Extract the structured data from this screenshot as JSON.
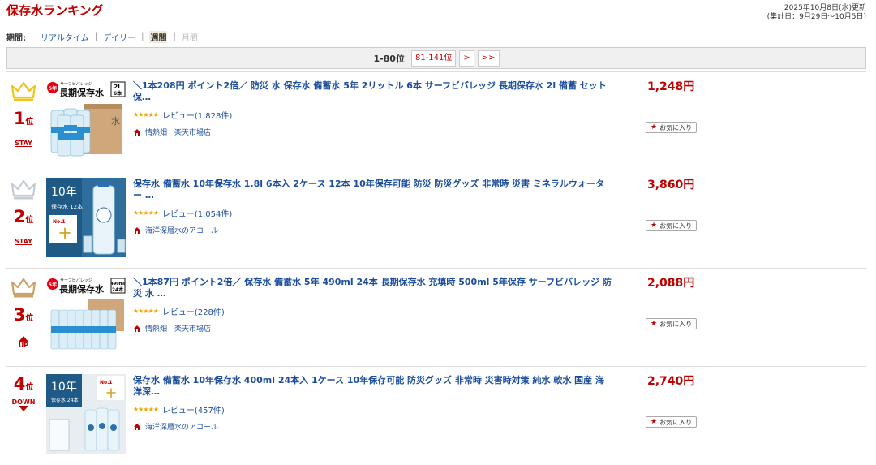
{
  "header": {
    "title": "保存水ランキング",
    "updated": "2025年10月8日(水)更新",
    "period_range": "(集計日：9月29日～10月5日)"
  },
  "period": {
    "label": "期間:",
    "realtime": "リアルタイム",
    "daily": "デイリー",
    "weekly": "週間",
    "monthly": "月間",
    "separator": "|"
  },
  "pager": {
    "current": "1-80位",
    "next_range": "81-141位",
    "next": ">",
    "last": ">>"
  },
  "favorite_label": "お気に入り",
  "colors": {
    "accent": "#bf0000",
    "link": "#1d4e9e",
    "gold": "#f0c419",
    "silver": "#c4ccd6",
    "bronze": "#c9a36a"
  },
  "items": [
    {
      "rank": "1",
      "rank_suffix": "位",
      "crown": "gold-crown-icon",
      "trend": "STAY",
      "title": "＼1本208円 ポイント2倍／ 防災 水 保存水 備蓄水 5年 2リットル 6本 サーフビバレッジ 長期保存水 2l 備蓄 セット 保…",
      "stars": "★★★★★",
      "reviews": "レビュー(1,828件)",
      "shop": "情熱畑　楽天市場店",
      "price": "1,248円",
      "img": {
        "badge": "5年",
        "brand": "サーフビバレッジ",
        "name": "長期保存水",
        "size1": "2L",
        "size2": "6本"
      }
    },
    {
      "rank": "2",
      "rank_suffix": "位",
      "crown": "silver-crown-icon",
      "trend": "STAY",
      "title": "保存水 備蓄水 10年保存水 1.8l 6本入 2ケース 12本 10年保存可能 防災 防災グッズ 非常時 災害 ミネラルウォーター …",
      "stars": "★★★★★",
      "reviews": "レビュー(1,054件)",
      "shop": "海洋深層水のアコール",
      "price": "3,860円",
      "img": {
        "years": "10年",
        "label": "保存水 12本",
        "badge": "No.1"
      }
    },
    {
      "rank": "3",
      "rank_suffix": "位",
      "crown": "bronze-crown-icon",
      "trend": "UP",
      "title": "＼1本87円 ポイント2倍／ 保存水 備蓄水 5年 490ml 24本 長期保存水 充填時 500ml 5年保存 サーフビバレッジ 防災 水 …",
      "stars": "★★★★★",
      "reviews": "レビュー(228件)",
      "shop": "情熱畑　楽天市場店",
      "price": "2,088円",
      "img": {
        "badge": "5年",
        "brand": "サーフビバレッジ",
        "name": "長期保存水",
        "size1": "490ml",
        "size2": "24本"
      }
    },
    {
      "rank": "4",
      "rank_suffix": "位",
      "crown": "",
      "trend": "DOWN",
      "title": "保存水 備蓄水 10年保存水 400ml 24本入 1ケース 10年保存可能 防災グッズ 非常時 災害時対策 純水 軟水 国産 海洋深…",
      "stars": "★★★★★",
      "reviews": "レビュー(457件)",
      "shop": "海洋深層水のアコール",
      "price": "2,740円",
      "img": {
        "years": "10年",
        "label": "保存水 24本",
        "badge": "No.1"
      }
    }
  ]
}
